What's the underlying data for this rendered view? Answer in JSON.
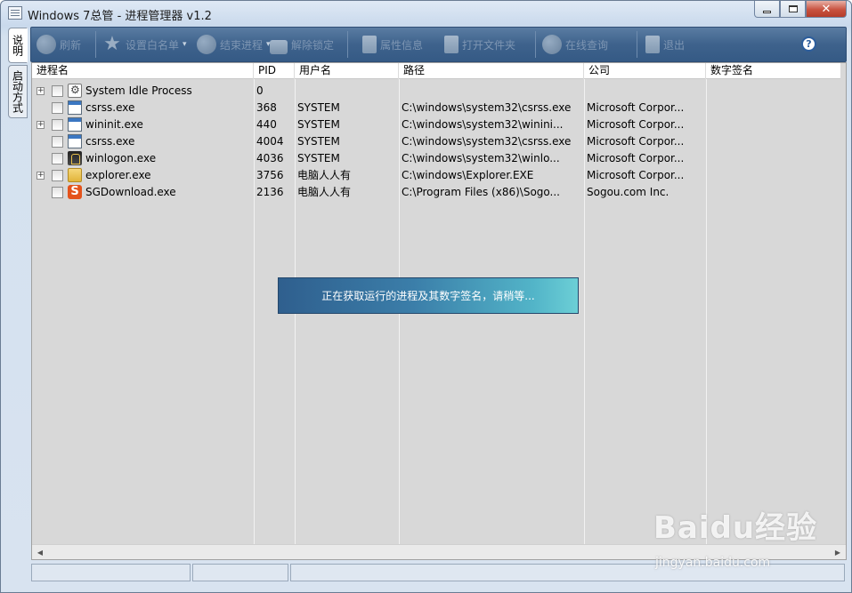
{
  "window": {
    "title": "Windows 7总管 - 进程管理器 v1.2"
  },
  "side_tabs": [
    {
      "label": "说明"
    },
    {
      "label": "启动方式"
    }
  ],
  "toolbar": {
    "items": [
      {
        "label": "刷新",
        "icon": "refresh-icon"
      },
      {
        "label": "设置白名单",
        "icon": "star-icon",
        "dropdown": true
      },
      {
        "label": "结束进程",
        "icon": "stop-hand-icon",
        "dropdown": true
      },
      {
        "label": "解除锁定",
        "icon": "unlock-icon"
      },
      {
        "label": "属性信息",
        "icon": "properties-icon"
      },
      {
        "label": "打开文件夹",
        "icon": "open-folder-icon"
      },
      {
        "label": "在线查询",
        "icon": "globe-icon"
      },
      {
        "label": "退出",
        "icon": "exit-icon"
      }
    ],
    "help_label": "?"
  },
  "columns": [
    "进程名",
    "PID",
    "用户名",
    "路径",
    "公司",
    "数字签名"
  ],
  "rows": [
    {
      "name": "System Idle Process",
      "pid": "0",
      "user": "",
      "path": "",
      "company": "",
      "signature": "",
      "expandable": true,
      "icon": "gear"
    },
    {
      "name": "csrss.exe",
      "pid": "368",
      "user": "SYSTEM",
      "path": "C:\\windows\\system32\\csrss.exe",
      "company": "Microsoft Corpor...",
      "signature": "",
      "expandable": false,
      "icon": "window"
    },
    {
      "name": "wininit.exe",
      "pid": "440",
      "user": "SYSTEM",
      "path": "C:\\windows\\system32\\winini...",
      "company": "Microsoft Corpor...",
      "signature": "",
      "expandable": true,
      "icon": "window"
    },
    {
      "name": "csrss.exe",
      "pid": "4004",
      "user": "SYSTEM",
      "path": "C:\\windows\\system32\\csrss.exe",
      "company": "Microsoft Corpor...",
      "signature": "",
      "expandable": false,
      "icon": "window"
    },
    {
      "name": "winlogon.exe",
      "pid": "4036",
      "user": "SYSTEM",
      "path": "C:\\windows\\system32\\winlo...",
      "company": "Microsoft Corpor...",
      "signature": "",
      "expandable": false,
      "icon": "logon"
    },
    {
      "name": "explorer.exe",
      "pid": "3756",
      "user": "电脑人人有",
      "path": "C:\\windows\\Explorer.EXE",
      "company": "Microsoft Corpor...",
      "signature": "",
      "expandable": true,
      "icon": "folder"
    },
    {
      "name": "SGDownload.exe",
      "pid": "2136",
      "user": "电脑人人有",
      "path": "C:\\Program Files (x86)\\Sogo...",
      "company": "Sogou.com Inc.",
      "signature": "",
      "expandable": false,
      "icon": "sogou"
    }
  ],
  "loading_message": "正在获取运行的进程及其数字签名，请稍等...",
  "watermark": {
    "brand": "Baidu经验",
    "url": "jingyan.baidu.com"
  },
  "colors": {
    "toolbar": "#3e628c",
    "list_bg": "#d8d8d8",
    "overlay_start": "#2f5f8e",
    "overlay_end": "#6ccfd6"
  }
}
